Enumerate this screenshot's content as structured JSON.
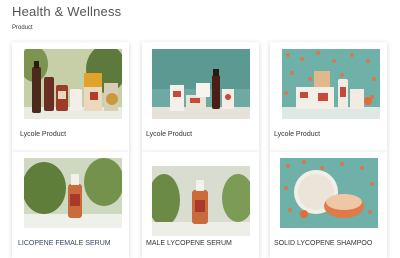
{
  "page": {
    "title": "Health & Wellness",
    "breadcrumb": "Product"
  },
  "products": [
    {
      "label": "Lycole Product"
    },
    {
      "label": "Lycole Product"
    },
    {
      "label": "Lycole Product"
    },
    {
      "label": "LICOPENE FEMALE SERUM"
    },
    {
      "label": "MALE LYCOPENE SERUM"
    },
    {
      "label": "SOLID LYCOPENE SHAMPOO"
    }
  ]
}
